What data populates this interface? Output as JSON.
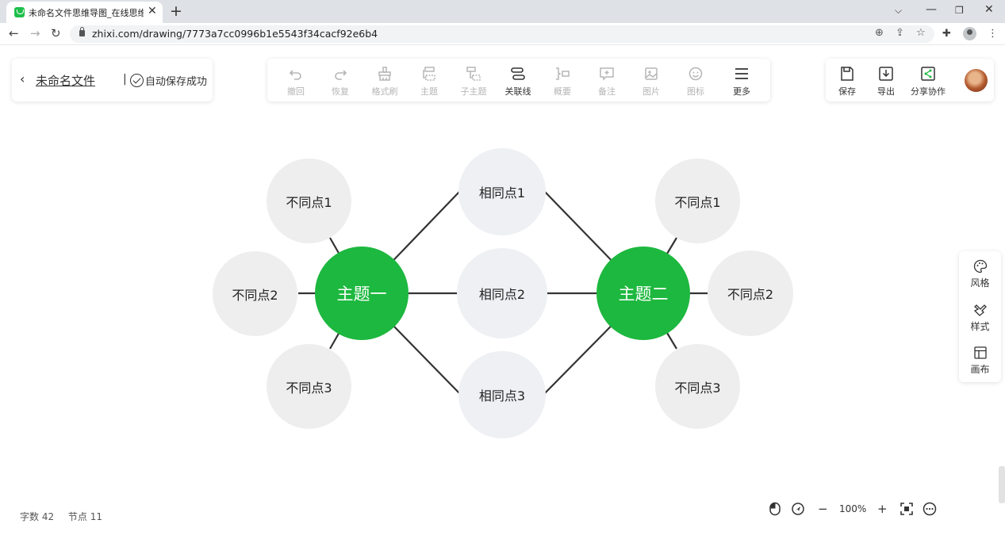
{
  "browser": {
    "tab_title": "未命名文件思维导图_在线思维导图",
    "url": "zhixi.com/drawing/7773a7cc0996b1e5543f34cacf92e6b4"
  },
  "file": {
    "name": "未命名文件",
    "save_status": "自动保存成功"
  },
  "toolbar": {
    "tools": [
      {
        "label": "撤回",
        "icon": "undo-icon"
      },
      {
        "label": "恢复",
        "icon": "redo-icon"
      },
      {
        "label": "格式刷",
        "icon": "format-brush-icon"
      },
      {
        "label": "主题",
        "icon": "topic-icon"
      },
      {
        "label": "子主题",
        "icon": "subtopic-icon"
      },
      {
        "label": "关联线",
        "icon": "link-icon"
      },
      {
        "label": "概要",
        "icon": "summary-icon"
      },
      {
        "label": "备注",
        "icon": "note-icon"
      },
      {
        "label": "图片",
        "icon": "image-icon"
      },
      {
        "label": "图标",
        "icon": "emoji-icon"
      },
      {
        "label": "更多",
        "icon": "menu-icon"
      }
    ],
    "right": {
      "save": "保存",
      "export": "导出",
      "share": "分享协作"
    }
  },
  "mindmap": {
    "topic1": "主题一",
    "topic2": "主题二",
    "same": [
      "相同点1",
      "相同点2",
      "相同点3"
    ],
    "diff_left": [
      "不同点1",
      "不同点2",
      "不同点3"
    ],
    "diff_right": [
      "不同点1",
      "不同点2",
      "不同点3"
    ],
    "colors": {
      "topic": "#1db83f",
      "diff": "#eeeeee",
      "same": "#eef0f3",
      "line": "#333333"
    }
  },
  "side_panel": {
    "style_theme": "风格",
    "style": "样式",
    "canvas": "画布"
  },
  "status": {
    "word_count": "字数 42",
    "node_count": "节点 11"
  },
  "zoom": {
    "value": "100%",
    "minus": "−",
    "plus": "+"
  }
}
